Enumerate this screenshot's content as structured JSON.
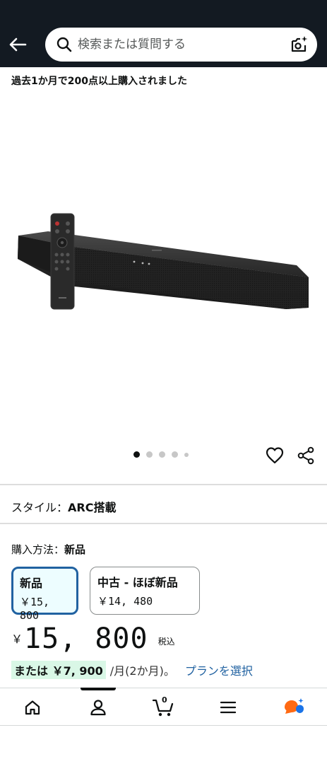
{
  "header": {
    "back_icon": "arrow-left-icon",
    "search_placeholder": "検索または質問する",
    "camera_icon": "camera-search-icon"
  },
  "social_proof": "過去1か月で200点以上購入されました",
  "carousel": {
    "total": 5,
    "active": 1
  },
  "style": {
    "label": "スタイル：",
    "value": "ARC搭載"
  },
  "purchase": {
    "label": "購入方法：",
    "value": "新品",
    "options": [
      {
        "title": "新品",
        "price": "￥15, 800",
        "selected": true
      },
      {
        "title": "中古 - ほぼ新品",
        "price": "￥14, 480",
        "selected": false
      }
    ]
  },
  "price": {
    "currency": "￥",
    "amount": "15, 800",
    "tax": "税込"
  },
  "installment": {
    "highlight": "または ￥7, 900",
    "detail": "/月(2か月)。",
    "link": "プランを選択"
  },
  "bottom_nav": {
    "items": [
      "home-icon",
      "account-icon",
      "cart-icon",
      "menu-icon",
      "rufus-ai-icon"
    ],
    "cart_count": "0"
  },
  "colors": {
    "header_bg": "#131a22",
    "link": "#2162a1",
    "selected_border": "#2162a1",
    "installment_bg": "#d9f7e6"
  }
}
